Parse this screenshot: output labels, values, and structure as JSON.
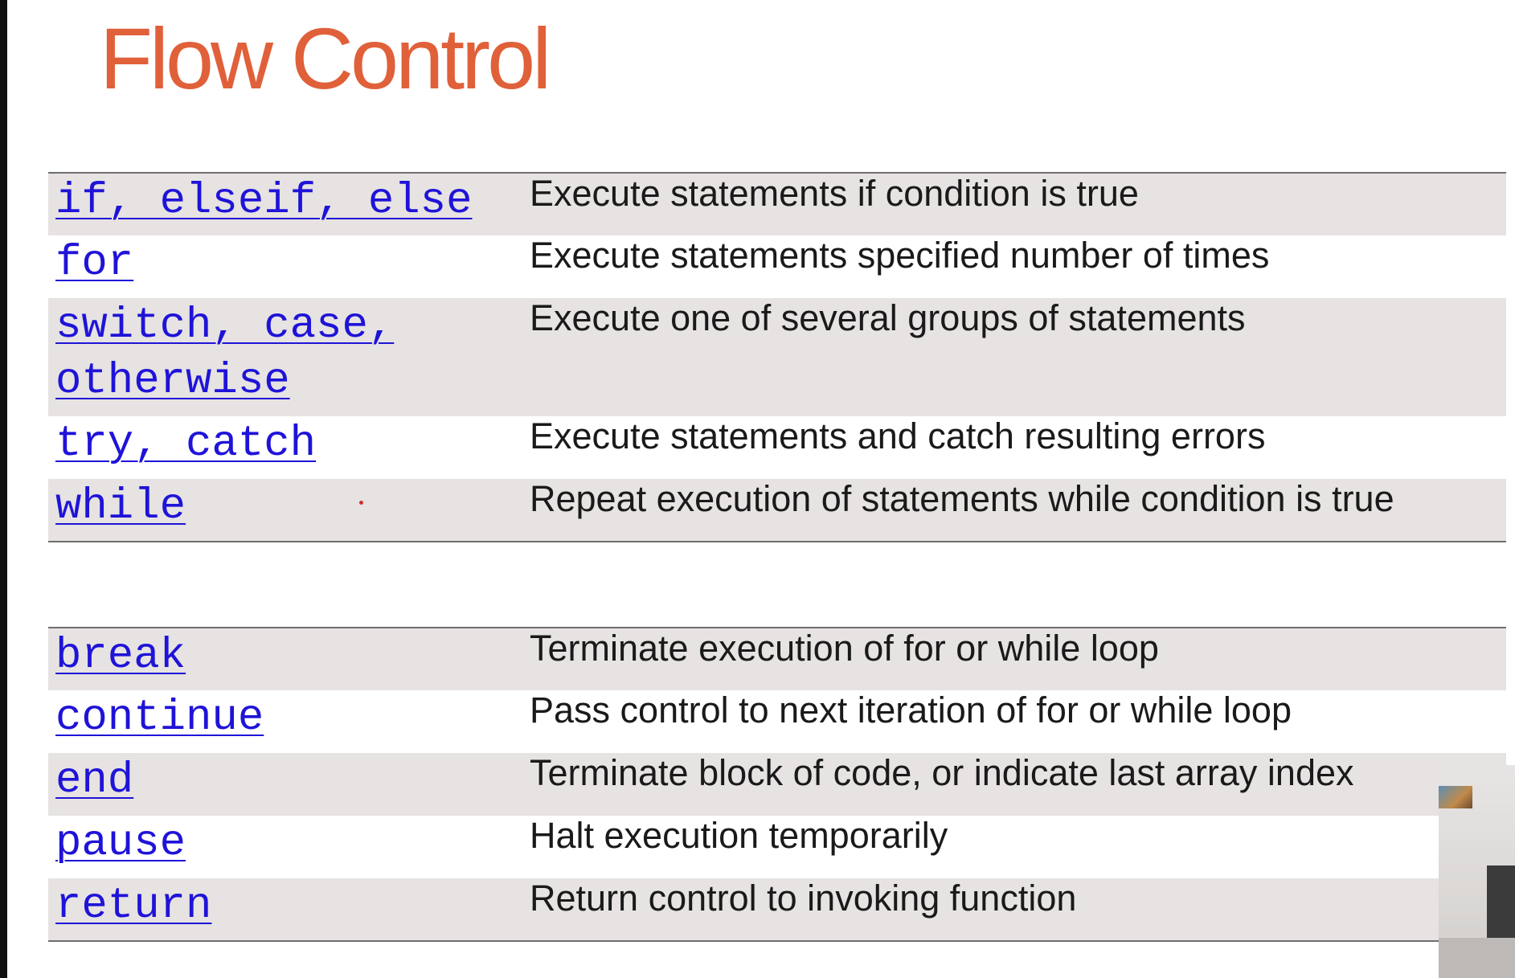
{
  "title": "Flow Control",
  "table1": [
    {
      "keyword": "if, elseif, else",
      "description": "Execute statements if condition is true"
    },
    {
      "keyword": "for",
      "description": "Execute statements specified number of times"
    },
    {
      "keyword": "switch, case,\notherwise",
      "description": "Execute one of several groups of statements"
    },
    {
      "keyword": "try, catch",
      "description": "Execute statements and catch resulting errors"
    },
    {
      "keyword": "while",
      "description": "Repeat execution of statements while condition is true"
    }
  ],
  "table2": [
    {
      "keyword": "break",
      "description": "Terminate execution of for or while loop"
    },
    {
      "keyword": "continue",
      "description": "Pass control to next iteration of for or while loop"
    },
    {
      "keyword": "end",
      "description": "Terminate block of code, or indicate last array index"
    },
    {
      "keyword": "pause",
      "description": "Halt execution temporarily"
    },
    {
      "keyword": "return",
      "description": "Return control to invoking function"
    }
  ],
  "colors": {
    "title": "#e0603a",
    "link": "#1f13d8",
    "row_shade": "#e6e3e2",
    "rule": "#6e6e6e"
  }
}
